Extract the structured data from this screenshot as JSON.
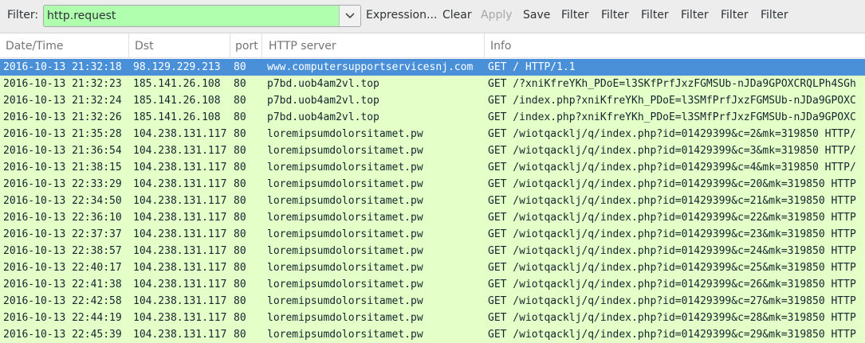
{
  "toolbar": {
    "filter_label": "Filter:",
    "filter_value": "http.request",
    "buttons": [
      "Expression...",
      "Clear",
      "Apply",
      "Save",
      "Filter",
      "Filter",
      "Filter",
      "Filter",
      "Filter",
      "Filter"
    ],
    "disabled": [
      "Apply"
    ],
    "filter_ok_color": "#afffaf"
  },
  "columns": [
    "Date/Time",
    "Dst",
    "port",
    "HTTP server",
    "Info"
  ],
  "selected_row": 0,
  "colors": {
    "row_bg": "#e4ffc7",
    "selected_bg": "#4a90d9"
  },
  "rows": [
    {
      "time": "2016-10-13 21:32:18",
      "dst": "98.129.229.213",
      "port": "80",
      "host": "www.computersupportservicesnj.com",
      "info": "GET / HTTP/1.1"
    },
    {
      "time": "2016-10-13 21:32:23",
      "dst": "185.141.26.108",
      "port": "80",
      "host": "p7bd.uob4am2vl.top",
      "info": "GET /?xniKfreYKh_PDoE=l3SKfPrfJxzFGMSUb-nJDa9GPOXCRQLPh4SGh"
    },
    {
      "time": "2016-10-13 21:32:24",
      "dst": "185.141.26.108",
      "port": "80",
      "host": "p7bd.uob4am2vl.top",
      "info": "GET /index.php?xniKfreYKh_PDoE=l3SMfPrfJxzFGMSUb-nJDa9GPOXC"
    },
    {
      "time": "2016-10-13 21:32:26",
      "dst": "185.141.26.108",
      "port": "80",
      "host": "p7bd.uob4am2vl.top",
      "info": "GET /index.php?xniKfreYKh_PDoE=l3SMfPrfJxzFGMSUb-nJDa9GPOXC"
    },
    {
      "time": "2016-10-13 21:35:28",
      "dst": "104.238.131.117",
      "port": "80",
      "host": "loremipsumdolorsitamet.pw",
      "info": "GET /wiotqacklj/q/index.php?id=01429399&c=2&mk=319850 HTTP/"
    },
    {
      "time": "2016-10-13 21:36:54",
      "dst": "104.238.131.117",
      "port": "80",
      "host": "loremipsumdolorsitamet.pw",
      "info": "GET /wiotqacklj/q/index.php?id=01429399&c=3&mk=319850 HTTP/"
    },
    {
      "time": "2016-10-13 21:38:15",
      "dst": "104.238.131.117",
      "port": "80",
      "host": "loremipsumdolorsitamet.pw",
      "info": "GET /wiotqacklj/q/index.php?id=01429399&c=4&mk=319850 HTTP/"
    },
    {
      "time": "2016-10-13 22:33:29",
      "dst": "104.238.131.117",
      "port": "80",
      "host": "loremipsumdolorsitamet.pw",
      "info": "GET /wiotqacklj/q/index.php?id=01429399&c=20&mk=319850 HTTP"
    },
    {
      "time": "2016-10-13 22:34:50",
      "dst": "104.238.131.117",
      "port": "80",
      "host": "loremipsumdolorsitamet.pw",
      "info": "GET /wiotqacklj/q/index.php?id=01429399&c=21&mk=319850 HTTP"
    },
    {
      "time": "2016-10-13 22:36:10",
      "dst": "104.238.131.117",
      "port": "80",
      "host": "loremipsumdolorsitamet.pw",
      "info": "GET /wiotqacklj/q/index.php?id=01429399&c=22&mk=319850 HTTP"
    },
    {
      "time": "2016-10-13 22:37:37",
      "dst": "104.238.131.117",
      "port": "80",
      "host": "loremipsumdolorsitamet.pw",
      "info": "GET /wiotqacklj/q/index.php?id=01429399&c=23&mk=319850 HTTP"
    },
    {
      "time": "2016-10-13 22:38:57",
      "dst": "104.238.131.117",
      "port": "80",
      "host": "loremipsumdolorsitamet.pw",
      "info": "GET /wiotqacklj/q/index.php?id=01429399&c=24&mk=319850 HTTP"
    },
    {
      "time": "2016-10-13 22:40:17",
      "dst": "104.238.131.117",
      "port": "80",
      "host": "loremipsumdolorsitamet.pw",
      "info": "GET /wiotqacklj/q/index.php?id=01429399&c=25&mk=319850 HTTP"
    },
    {
      "time": "2016-10-13 22:41:38",
      "dst": "104.238.131.117",
      "port": "80",
      "host": "loremipsumdolorsitamet.pw",
      "info": "GET /wiotqacklj/q/index.php?id=01429399&c=26&mk=319850 HTTP"
    },
    {
      "time": "2016-10-13 22:42:58",
      "dst": "104.238.131.117",
      "port": "80",
      "host": "loremipsumdolorsitamet.pw",
      "info": "GET /wiotqacklj/q/index.php?id=01429399&c=27&mk=319850 HTTP"
    },
    {
      "time": "2016-10-13 22:44:19",
      "dst": "104.238.131.117",
      "port": "80",
      "host": "loremipsumdolorsitamet.pw",
      "info": "GET /wiotqacklj/q/index.php?id=01429399&c=28&mk=319850 HTTP"
    },
    {
      "time": "2016-10-13 22:45:39",
      "dst": "104.238.131.117",
      "port": "80",
      "host": "loremipsumdolorsitamet.pw",
      "info": "GET /wiotqacklj/q/index.php?id=01429399&c=29&mk=319850 HTTP"
    }
  ]
}
